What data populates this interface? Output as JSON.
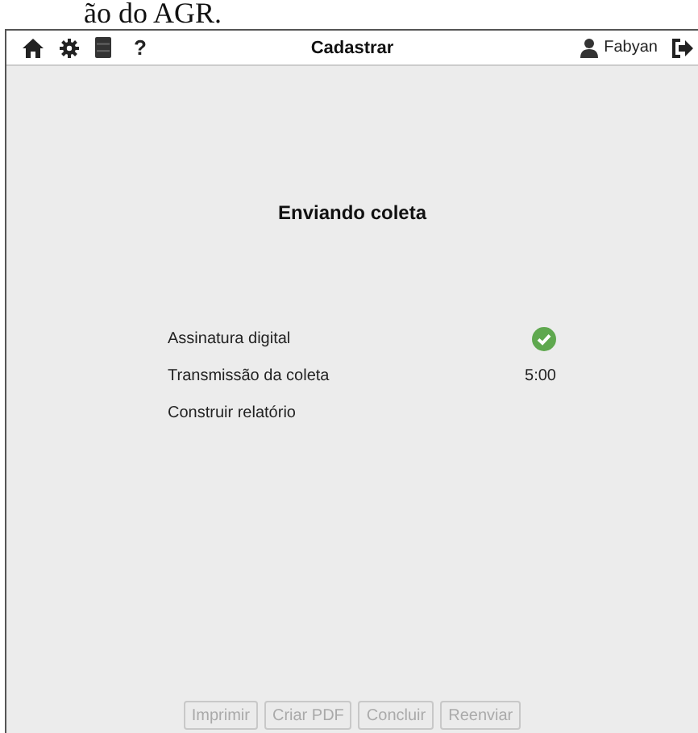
{
  "document_fragment": "ão do AGR.",
  "header": {
    "help": "?",
    "title": "Cadastrar",
    "user": "Fabyan"
  },
  "heading": "Enviando coleta",
  "steps": [
    {
      "label": "Assinatura digital",
      "kind": "done"
    },
    {
      "label": "Transmissão da coleta",
      "kind": "timer",
      "reading": "5:00"
    },
    {
      "label": "Construir relatório",
      "kind": "pending"
    }
  ],
  "buttons": [
    {
      "label": "Imprimir",
      "disabled": true
    },
    {
      "label": "Criar PDF",
      "disabled": true
    },
    {
      "label": "Concluir",
      "disabled": true
    },
    {
      "label": "Reenviar",
      "disabled": true
    }
  ]
}
